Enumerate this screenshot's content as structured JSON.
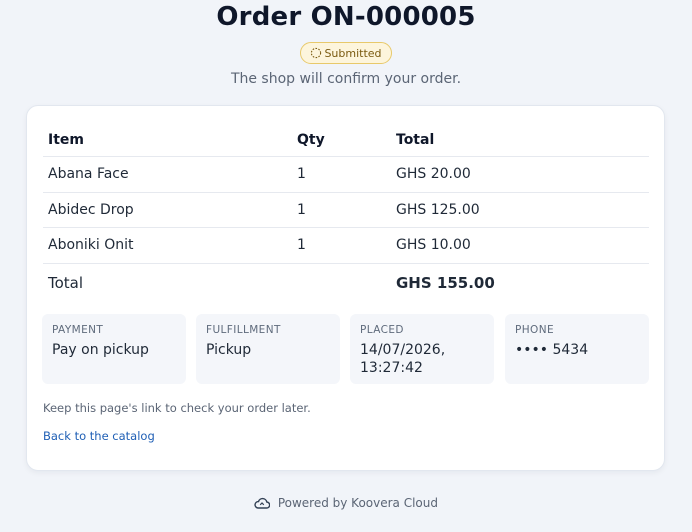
{
  "header": {
    "title": "Order ON-000005",
    "status": "Submitted",
    "subtitle": "The shop will confirm your order."
  },
  "table": {
    "columns": [
      "Item",
      "Qty",
      "Total"
    ],
    "rows": [
      {
        "item": "Abana Face",
        "qty": "1",
        "total": "GHS 20.00"
      },
      {
        "item": "Abidec Drop",
        "qty": "1",
        "total": "GHS 125.00"
      },
      {
        "item": "Aboniki Onit",
        "qty": "1",
        "total": "GHS 10.00"
      }
    ],
    "total_label": "Total",
    "total_value": "GHS 155.00"
  },
  "details": {
    "payment": {
      "label": "PAYMENT",
      "value": "Pay on pickup"
    },
    "fulfillment": {
      "label": "FULFILLMENT",
      "value": "Pickup"
    },
    "placed": {
      "label": "PLACED",
      "value_line1": "14/07/2026,",
      "value_line2": "13:27:42"
    },
    "phone": {
      "label": "PHONE",
      "value": "•••• 5434"
    }
  },
  "note": "Keep this page's link to check your order later.",
  "back_link": "Back to the catalog",
  "footer": {
    "text": "Powered by Koovera Cloud",
    "icon": "cloud-icon"
  },
  "colors": {
    "status_bg": "#fdf5dc",
    "status_border": "#e8c96a",
    "link": "#1f5fb5"
  }
}
